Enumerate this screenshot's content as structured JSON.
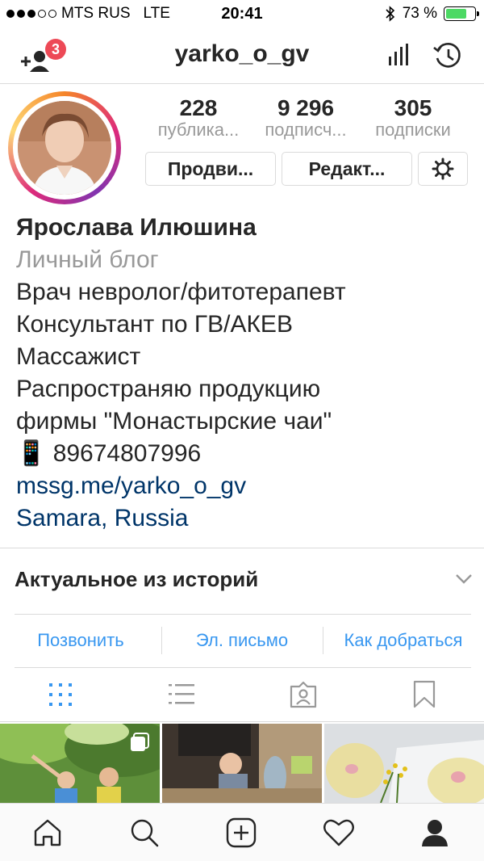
{
  "status_bar": {
    "carrier": "MTS RUS",
    "network": "LTE",
    "time": "20:41",
    "battery_text": "73 %",
    "battery_level": 0.73
  },
  "header": {
    "username": "yarko_o_gv",
    "notification_count": "3"
  },
  "stats": [
    {
      "value": "228",
      "label": "публика..."
    },
    {
      "value": "9 296",
      "label": "подписч..."
    },
    {
      "value": "305",
      "label": "подписки"
    }
  ],
  "buttons": {
    "promote": "Продви...",
    "edit": "Редакт..."
  },
  "bio": {
    "name": "Ярослава Илюшина",
    "category": "Личный блог",
    "lines": [
      "Врач невролог/фитотерапевт",
      "Консультант по ГВ/АКЕВ",
      "Массажист",
      "Распространяю продукцию",
      "фирмы \"Монастырские чаи\"",
      "📱 89674807996"
    ],
    "link": "mssg.me/yarko_o_gv",
    "location": "Samara, Russia"
  },
  "highlights_title": "Актуальное из историй",
  "contact": {
    "call": "Позвонить",
    "email": "Эл. письмо",
    "directions": "Как добраться"
  },
  "colors": {
    "accent": "#3897f0",
    "link": "#003569",
    "badge": "#ed4956",
    "battery": "#4cd964"
  }
}
